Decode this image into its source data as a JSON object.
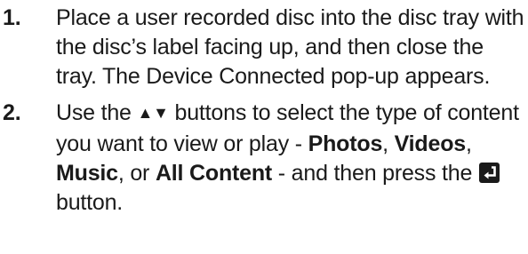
{
  "steps": [
    {
      "number": "1.",
      "text": "Place a user recorded disc into the disc tray with the disc’s label facing up, and then close the tray. The Device Connected pop-up appears."
    },
    {
      "number": "2.",
      "text_before_arrows": "Use the ",
      "up_arrow": "▲",
      "down_arrow": "▼",
      "text_after_arrows": " buttons to select the type of content you want to view or play - ",
      "option_photos": "Photos",
      "sep1": ", ",
      "option_videos": "Videos",
      "sep2": ", ",
      "option_music": "Music",
      "sep3": ", or ",
      "option_all": "All Content",
      "text_before_enter": " - and then press the ",
      "enter_icon": "enter-button-icon",
      "text_after_enter": " button."
    }
  ]
}
